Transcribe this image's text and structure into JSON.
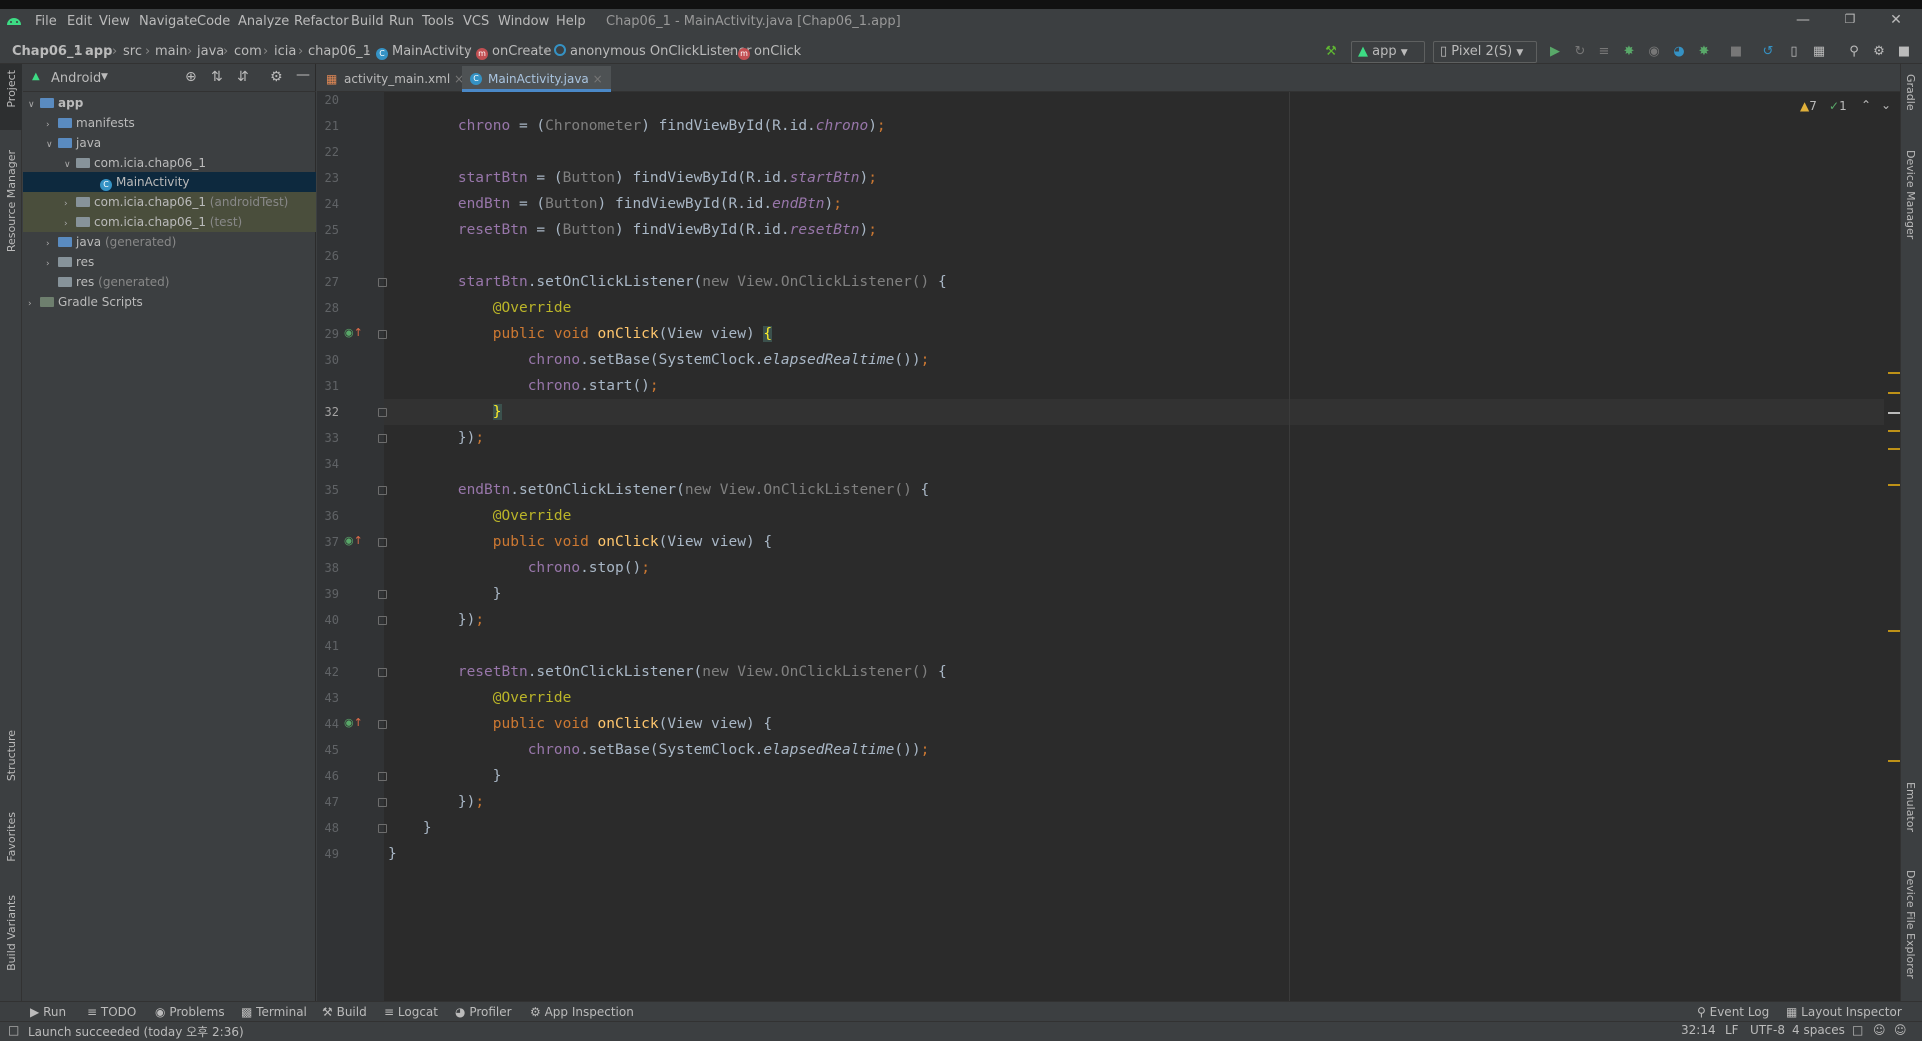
{
  "window": {
    "title": "Chap06_1 - MainActivity.java [Chap06_1.app]"
  },
  "menu": [
    "File",
    "Edit",
    "View",
    "Navigate",
    "Code",
    "Analyze",
    "Refactor",
    "Build",
    "Run",
    "Tools",
    "VCS",
    "Window",
    "Help"
  ],
  "breadcrumbs": [
    "Chap06_1",
    "app",
    "src",
    "main",
    "java",
    "com",
    "icia",
    "chap06_1",
    "MainActivity",
    "onCreate",
    "anonymous OnClickListener",
    "onClick"
  ],
  "toolbar": {
    "run_config": "app",
    "device": "Pixel 2(S)"
  },
  "left_stripe": [
    "Project",
    "Resource Manager",
    "Structure",
    "Favorites",
    "Build Variants"
  ],
  "right_stripe": [
    "Gradle",
    "Device Manager",
    "Emulator",
    "Device File Explorer"
  ],
  "project": {
    "view_mode": "Android",
    "tree": [
      {
        "label": "app",
        "suffix": ""
      },
      {
        "label": "manifests",
        "suffix": ""
      },
      {
        "label": "java",
        "suffix": ""
      },
      {
        "label": "com.icia.chap06_1",
        "suffix": ""
      },
      {
        "label": "MainActivity",
        "suffix": ""
      },
      {
        "label": "com.icia.chap06_1",
        "suffix": "(androidTest)"
      },
      {
        "label": "com.icia.chap06_1",
        "suffix": "(test)"
      },
      {
        "label": "java",
        "suffix": "(generated)"
      },
      {
        "label": "res",
        "suffix": ""
      },
      {
        "label": "res",
        "suffix": "(generated)"
      },
      {
        "label": "Gradle Scripts",
        "suffix": ""
      }
    ]
  },
  "tabs": [
    {
      "label": "activity_main.xml"
    },
    {
      "label": "MainActivity.java"
    }
  ],
  "inspections": {
    "warnings": "7",
    "ok": "1"
  },
  "line_numbers": [
    "20",
    "21",
    "22",
    "23",
    "24",
    "25",
    "26",
    "27",
    "28",
    "29",
    "30",
    "31",
    "32",
    "33",
    "34",
    "35",
    "36",
    "37",
    "38",
    "39",
    "40",
    "41",
    "42",
    "43",
    "44",
    "45",
    "46",
    "47",
    "48",
    "49"
  ],
  "bottom_tools": [
    "Run",
    "TODO",
    "Problems",
    "Terminal",
    "Build",
    "Logcat",
    "Profiler",
    "App Inspection",
    "Event Log",
    "Layout Inspector"
  ],
  "status": {
    "message": "Launch succeeded (today 오후 2:36)",
    "position": "32:14",
    "line_sep": "LF",
    "encoding": "UTF-8",
    "indent": "4 spaces"
  }
}
